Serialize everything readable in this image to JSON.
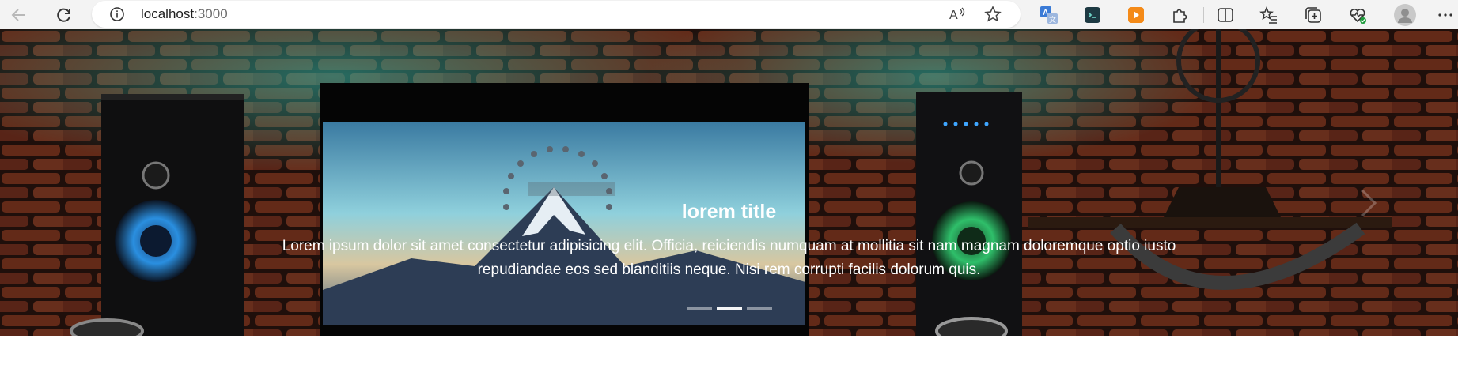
{
  "browser": {
    "url_host": "localhost",
    "url_port": ":3000",
    "icons": {
      "back": "back-arrow-icon",
      "reload": "reload-icon",
      "info": "info-icon",
      "read_aloud": "read-aloud-icon",
      "favorite": "favorite-star-icon",
      "translate": "translate-icon",
      "ext_terminal": "terminal-extension-icon",
      "ext_orange": "orange-extension-icon",
      "extensions": "extensions-puzzle-icon",
      "split": "split-screen-icon",
      "favorites": "favorites-list-icon",
      "collections": "collections-icon",
      "performance": "heart-pulse-icon",
      "profile": "profile-avatar-icon",
      "more": "more-icon"
    }
  },
  "hero": {
    "title": "lorem title",
    "text_line1": "Lorem ipsum dolor sit amet consectetur adipisicing elit. Officia, reiciendis numquam at mollitia sit nam magnam doloremque optio iusto",
    "text_line2": "repudiandae eos sed blanditiis neque. Nisi rem corrupti facilis dolorum quis.",
    "image_desc": "cinema-wall-icon",
    "slides_count": 3,
    "active_slide": 2
  },
  "colors": {
    "brick": "#8a3b22",
    "accent_teal": "#2fb7a7"
  }
}
